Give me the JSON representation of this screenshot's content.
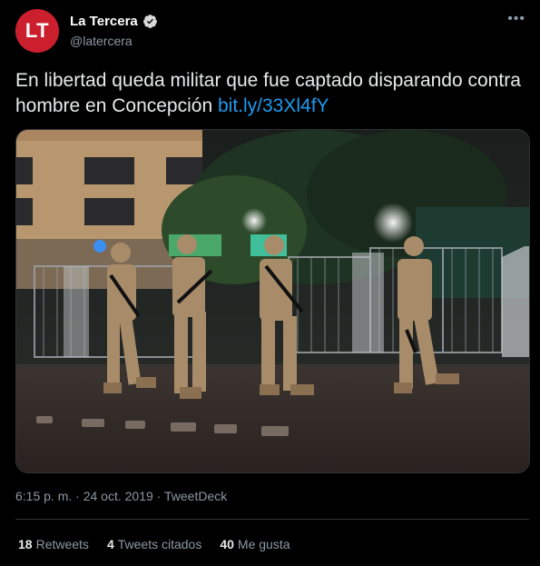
{
  "account": {
    "avatar_text": "LT",
    "display_name": "La Tercera",
    "handle": "@latercera",
    "verified": true
  },
  "tweet": {
    "text": "En libertad queda militar que fue captado disparando contra hombre en Concepción ",
    "link_text": "bit.ly/33Xl4fY"
  },
  "meta": {
    "time": "6:15 p. m.",
    "separator1": " · ",
    "date": "24 oct. 2019",
    "separator2": " · ",
    "source": "TweetDeck"
  },
  "stats": [
    {
      "count": "18",
      "label": "Retweets"
    },
    {
      "count": "4",
      "label": "Tweets citados"
    },
    {
      "count": "40",
      "label": "Me gusta"
    }
  ],
  "colors": {
    "background": "#000000",
    "link": "#1d9bf0",
    "avatar": "#cc1f2e",
    "muted": "#8b98a5"
  },
  "icons": [
    "verified-badge-icon",
    "more-options-icon"
  ]
}
